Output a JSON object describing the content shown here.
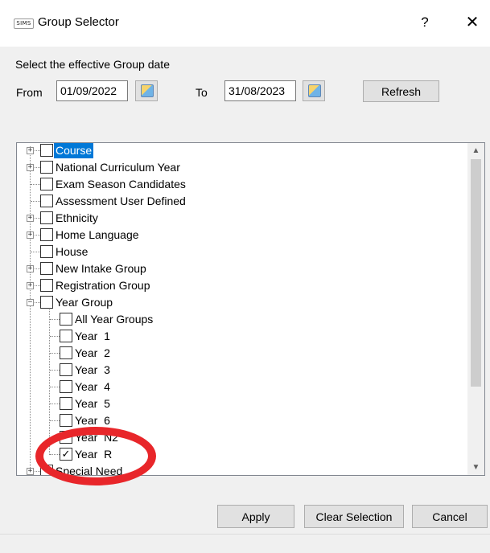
{
  "window": {
    "app_icon": "SIMS",
    "title": "Group Selector",
    "help_glyph": "?",
    "close_glyph": "✕"
  },
  "date_section": {
    "label": "Select the effective Group date",
    "from_label": "From",
    "from_value": "01/09/2022",
    "to_label": "To",
    "to_value": "31/08/2023",
    "refresh_label": "Refresh"
  },
  "tree": {
    "items": [
      {
        "label": "Course",
        "expander": "+",
        "checked": false,
        "selected": true
      },
      {
        "label": "National Curriculum Year",
        "expander": "+",
        "checked": false
      },
      {
        "label": "Exam Season Candidates",
        "expander": "",
        "checked": false
      },
      {
        "label": "Assessment User Defined",
        "expander": "",
        "checked": false
      },
      {
        "label": "Ethnicity",
        "expander": "+",
        "checked": false
      },
      {
        "label": "Home Language",
        "expander": "+",
        "checked": false
      },
      {
        "label": "House",
        "expander": "",
        "checked": false
      },
      {
        "label": "New Intake Group",
        "expander": "+",
        "checked": false
      },
      {
        "label": "Registration Group",
        "expander": "+",
        "checked": false
      },
      {
        "label": "Year Group",
        "expander": "−",
        "checked": false
      },
      {
        "label": "All Year Groups",
        "checked": false
      },
      {
        "label": "Year  1",
        "checked": false
      },
      {
        "label": "Year  2",
        "checked": false
      },
      {
        "label": "Year  3",
        "checked": false
      },
      {
        "label": "Year  4",
        "checked": false
      },
      {
        "label": "Year  5",
        "checked": false
      },
      {
        "label": "Year  6",
        "checked": false
      },
      {
        "label": "Year  N2",
        "checked": false
      },
      {
        "label": "Year  R",
        "checked": true
      },
      {
        "label": "Special Need",
        "expander": "+",
        "checked": false
      }
    ],
    "check_glyph": "✓",
    "scroll_up": "▲",
    "scroll_down": "▼"
  },
  "footer": {
    "apply_label": "Apply",
    "clear_label": "Clear Selection",
    "cancel_label": "Cancel"
  },
  "colors": {
    "selection": "#0078d7",
    "highlight": "#e8262a"
  }
}
